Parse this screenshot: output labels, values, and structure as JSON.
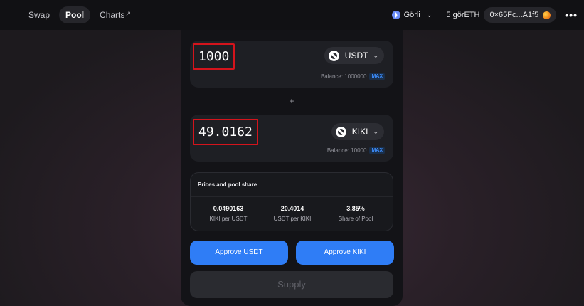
{
  "nav": {
    "items": [
      {
        "label": "Swap"
      },
      {
        "label": "Pool"
      },
      {
        "label": "Charts",
        "arrow": "↗"
      }
    ]
  },
  "header": {
    "network": "Görli",
    "balance": "5 görETH",
    "address": "0×65Fc...A1f5",
    "more": "•••"
  },
  "inputs": [
    {
      "amount": "1000",
      "token": "USDT",
      "balance": "Balance: 1000000",
      "max": "MAX"
    },
    {
      "amount": "49.0162",
      "token": "KIKI",
      "balance": "Balance: 10000",
      "max": "MAX"
    }
  ],
  "plus": "+",
  "prices": {
    "title": "Prices and pool share",
    "stats": [
      {
        "value": "0.0490163",
        "label": "KIKI per USDT"
      },
      {
        "value": "20.4014",
        "label": "USDT per KIKI"
      },
      {
        "value": "3.85%",
        "label": "Share of Pool"
      }
    ]
  },
  "buttons": {
    "approve_usdt": "Approve USDT",
    "approve_kiki": "Approve KIKI",
    "supply": "Supply"
  },
  "colors": {
    "accent": "#2f7df6",
    "highlight": "#d4141c",
    "max": "#3d8eff"
  }
}
